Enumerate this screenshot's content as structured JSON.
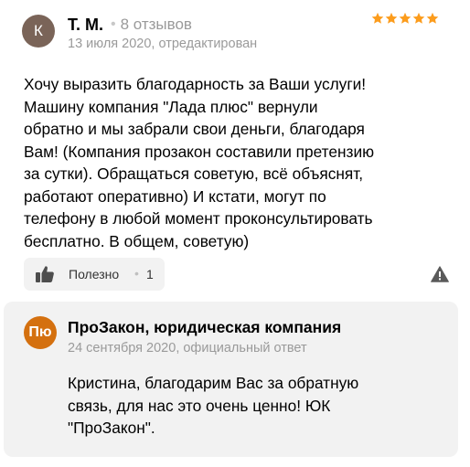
{
  "review": {
    "avatar_letter": "К",
    "avatar_color": "#7a6458",
    "author": "Т. М.",
    "reviews_count": "8 отзывов",
    "rating": 5,
    "rating_max": 5,
    "star_color": "#fc9c1c",
    "date": "13 июля 2020, отредактирован",
    "text_lines": [
      "Хочу выразить благодарность за Ваши услуги!",
      "Машину компания \"Лада плюс\" вернули",
      "обратно и мы забрали свои деньги, благодаря",
      "Вам! (Компания прозакон составили претензию",
      "за сутки). Обращаться советую, всё объяснят,",
      "работают оперативно) И кстати, могут по",
      "телефону в любой момент проконсультировать",
      "бесплатно. В общем, советую)"
    ],
    "helpful": {
      "icon": "thumbs-up-icon",
      "label": "Полезно",
      "count": "1"
    },
    "report_icon": "warning-icon"
  },
  "answer": {
    "logo_text": "Пю",
    "logo_color": "#d4700f",
    "company": "ПроЗакон, юридическая компания",
    "date": "24 сентября 2020, официальный ответ",
    "text_lines": [
      "Кристина, благодарим Вас за обратную",
      "связь, для нас это очень ценно! ЮК",
      "\"ПроЗакон\"."
    ]
  }
}
